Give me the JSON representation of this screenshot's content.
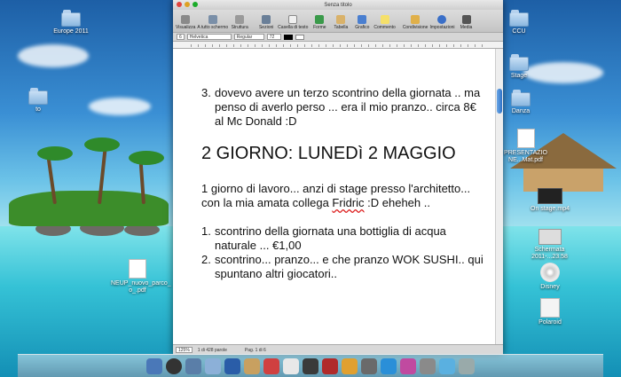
{
  "desktop": {
    "icons_left": [
      {
        "label": "Europe 2011",
        "kind": "folder"
      },
      {
        "label": "to",
        "kind": "folder"
      },
      {
        "label": "NEUP_nuovo_parco_ o_.pdf",
        "kind": "doc"
      }
    ],
    "icons_right": [
      {
        "label": "CCU",
        "kind": "folder"
      },
      {
        "label": "Stage",
        "kind": "folder"
      },
      {
        "label": "Danza",
        "kind": "folder"
      },
      {
        "label": "PRESENTAZIO NE...Mat.pdf",
        "kind": "doc"
      },
      {
        "label": "On stage.mp4",
        "kind": "movie"
      },
      {
        "label": "Schermata 2011-...23.58",
        "kind": "shot"
      },
      {
        "label": "Disney",
        "kind": "disc"
      },
      {
        "label": "Polaroid",
        "kind": "polaroid"
      }
    ]
  },
  "window": {
    "title": "Senza titolo",
    "toolbar": [
      "Visualizza",
      "A tutto schermo",
      "Struttura",
      "Sezioni",
      "Casella di testo",
      "Forme",
      "Tabella",
      "Grafico",
      "Commento",
      "Condivisione",
      "Impostazioni",
      "Media"
    ],
    "format": {
      "size_field": "6",
      "font": "Helvetica",
      "style": "Regular",
      "size": "72"
    },
    "status": {
      "zoom": "125%",
      "words": "1 di 428 parole",
      "page": "Pag. 1 di 6"
    }
  },
  "document": {
    "item3_num": "3.",
    "item3": "dovevo avere un terzo scontrino della giornata .. ma penso di averlo perso ... era il mio pranzo.. circa 8€ al Mc Donald :D",
    "heading": "2 GIORNO: LUNEDì 2 MAGGIO",
    "para_a": "1 giorno di lavoro... anzi di stage presso l'architetto... con la mia amata collega ",
    "para_red": "Fridric",
    "para_b": " :D eheheh ..",
    "item1_num": "1.",
    "item1": "scontrino della giornata una bottiglia di acqua naturale ... €1,00",
    "item2_num": "2.",
    "item2": " scontrino... pranzo... e che pranzo WOK SUSHI..  qui spuntano altri giocatori.."
  },
  "colors": {
    "accent": "#2e72c6",
    "spell_error": "#dd2222"
  }
}
